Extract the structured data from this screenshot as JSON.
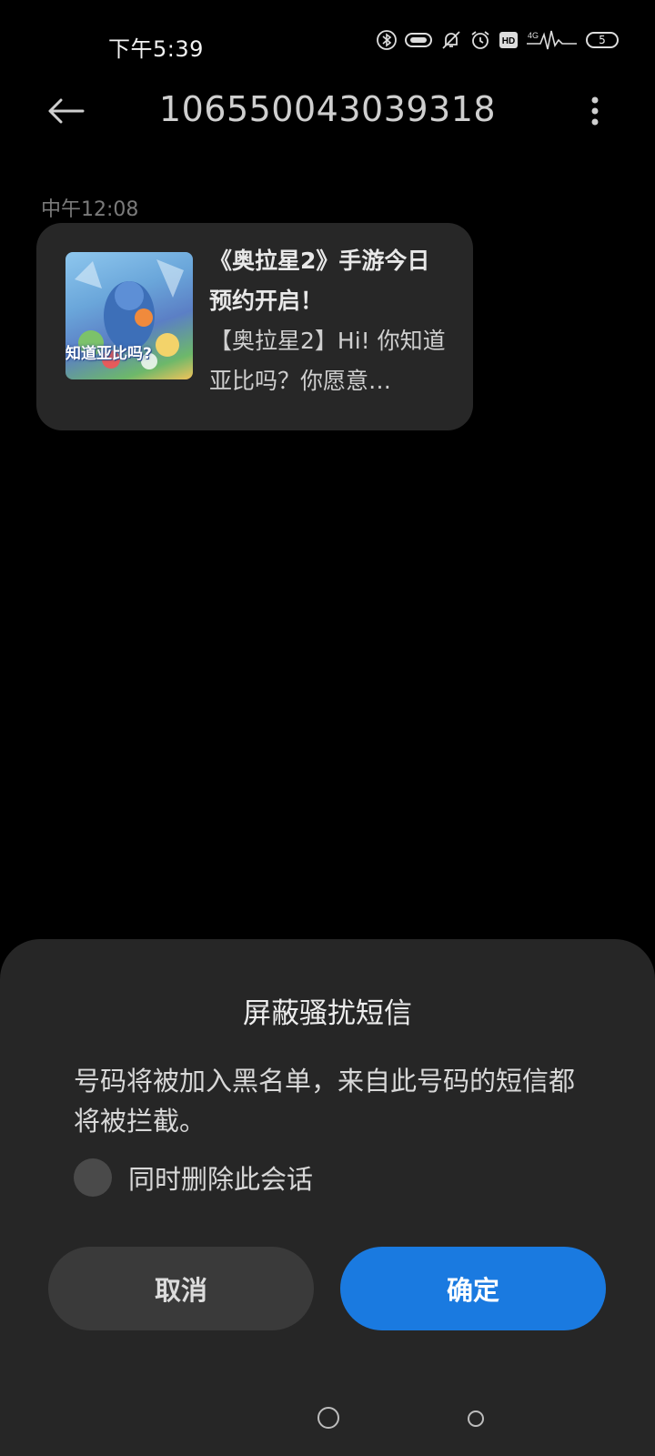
{
  "status_bar": {
    "time": "下午5:39",
    "battery": "5",
    "icons": [
      "bluetooth-icon",
      "link-icon",
      "bell-off-icon",
      "alarm-icon",
      "hd-icon",
      "signal-4g-icon",
      "battery-icon"
    ],
    "network_label": "4G",
    "hd_label": "HD"
  },
  "header": {
    "title": "106550043039318",
    "back_icon": "arrow-left-icon",
    "more_icon": "more-vertical-icon"
  },
  "message": {
    "time": "中午12:08",
    "thumb_text": "知道亚比吗?",
    "title": "《奥拉星2》手游今日预约开启！",
    "body": "【奥拉星2】Hi! 你知道亚比吗？你愿意…"
  },
  "dialog": {
    "title": "屏蔽骚扰短信",
    "description": "号码将被加入黑名单，来自此号码的短信都将被拦截。",
    "checkbox_label": "同时删除此会话",
    "cancel_label": "取消",
    "ok_label": "确定",
    "ok_color": "#1a7ae0"
  }
}
